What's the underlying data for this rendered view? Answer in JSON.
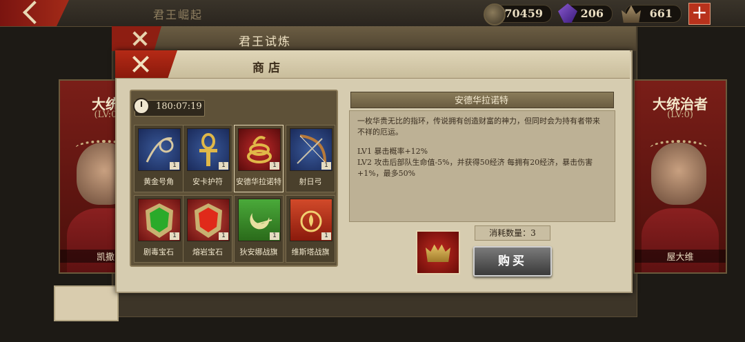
{
  "top_bar": {
    "title": "君王崛起",
    "resources": [
      {
        "icon": "coin-icon",
        "value": "70459"
      },
      {
        "icon": "purple-gem-icon",
        "value": "206"
      },
      {
        "icon": "crown-token-icon",
        "value": "661"
      }
    ],
    "add_label": "+"
  },
  "trial_panel": {
    "title": "君王试炼"
  },
  "heroes": {
    "left": {
      "title": "大统",
      "level": "(LV:0",
      "name": "凯撒"
    },
    "right": {
      "title": "大统治者",
      "level": "(LV:0)",
      "name": "屋大维"
    }
  },
  "shop": {
    "title": "商店",
    "timer": "180:07:19",
    "items": [
      {
        "name": "黄金号角",
        "qty": "1",
        "icon": "golden-horn-icon"
      },
      {
        "name": "安卡护符",
        "qty": "1",
        "icon": "ankh-amulet-icon"
      },
      {
        "name": "安德华拉诺特",
        "qty": "1",
        "icon": "serpent-ring-icon",
        "selected": true
      },
      {
        "name": "射日弓",
        "qty": "1",
        "icon": "sun-bow-icon"
      },
      {
        "name": "剧毒宝石",
        "qty": "1",
        "icon": "poison-gem-icon"
      },
      {
        "name": "熔岩宝石",
        "qty": "1",
        "icon": "lava-gem-icon"
      },
      {
        "name": "狄安娜战旗",
        "qty": "1",
        "icon": "diana-banner-icon"
      },
      {
        "name": "维斯塔战旗",
        "qty": "1",
        "icon": "vesta-banner-icon"
      }
    ],
    "detail": {
      "title": "安德华拉诺特",
      "description": "一枚华贵无比的指环，传说拥有创造财富的神力，但同时会为持有者带来不祥的厄运。",
      "lv1": "LV1 暴击概率+12%",
      "lv2": "LV2 攻击后部队生命值-5%，并获得50经济 每拥有20经济，暴击伤害+1%，最多50%"
    },
    "cost_label": "消耗数量：3",
    "cost_icon": "crown-shield-icon",
    "buy_label": "购买"
  },
  "colors": {
    "accent_red": "#b52a16",
    "parchment": "#d6ccb0"
  }
}
